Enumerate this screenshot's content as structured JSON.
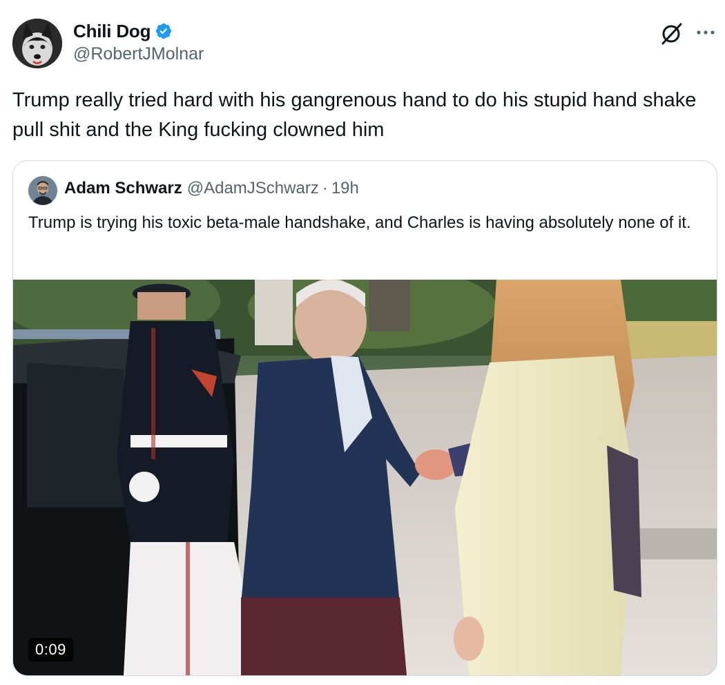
{
  "author": {
    "display_name": "Chili Dog",
    "handle": "@RobertJMolnar",
    "verified": true,
    "verified_color": "#1d9bf0"
  },
  "tweet": {
    "text": "Trump really tried hard with his gangrenous hand to do his stupid hand shake pull shit and the King fucking clowned him"
  },
  "header_icons": [
    "grok-icon",
    "more-options-icon"
  ],
  "quoted": {
    "display_name": "Adam Schwarz",
    "handle": "@AdamJSchwarz",
    "separator": "·",
    "time": "19h",
    "text": "Trump is trying his toxic beta-male handshake, and Charles is having absolutely none of it.",
    "media": {
      "type": "video",
      "duration": "0:09"
    }
  },
  "colors": {
    "text": "#0f1419",
    "secondary": "#536471",
    "border": "#cfd9de"
  }
}
